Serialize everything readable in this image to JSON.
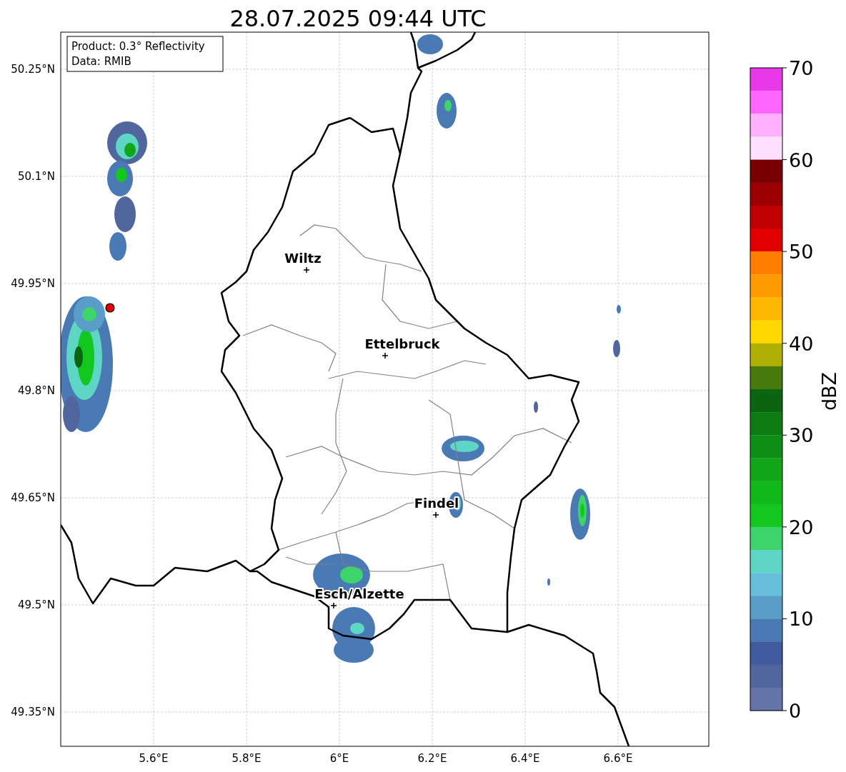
{
  "title": "28.07.2025 09:44 UTC",
  "map": {
    "info_lines": [
      "Product: 0.3° Reflectivity",
      "Data: RMIB"
    ],
    "lat_labels": [
      "50.25°N",
      "50.1°N",
      "49.95°N",
      "49.8°N",
      "49.65°N",
      "49.5°N",
      "49.35°N"
    ],
    "lon_labels": [
      "5.6°E",
      "5.8°E",
      "6°E",
      "6.2°E",
      "6.4°E",
      "6.6°E"
    ],
    "cities": [
      {
        "name": "Wiltz"
      },
      {
        "name": "Ettelbruck"
      },
      {
        "name": "Findel"
      },
      {
        "name": "Esch/Alzette"
      }
    ]
  },
  "colorbar": {
    "label": "dBZ",
    "ticks": [
      "70",
      "60",
      "50",
      "40",
      "30",
      "20",
      "10",
      "0"
    ],
    "bins": [
      {
        "color": "#e838e8"
      },
      {
        "color": "#ff66ff"
      },
      {
        "color": "#ffb0ff"
      },
      {
        "color": "#ffe0ff"
      },
      {
        "color": "#780000"
      },
      {
        "color": "#9c0000"
      },
      {
        "color": "#c00000"
      },
      {
        "color": "#e00000"
      },
      {
        "color": "#ff7e00"
      },
      {
        "color": "#ff9a00"
      },
      {
        "color": "#ffb800"
      },
      {
        "color": "#ffd800"
      },
      {
        "color": "#b0b004"
      },
      {
        "color": "#467a0a"
      },
      {
        "color": "#0a6410"
      },
      {
        "color": "#0c7c12"
      },
      {
        "color": "#0e8e14"
      },
      {
        "color": "#10a618"
      },
      {
        "color": "#10b81a"
      },
      {
        "color": "#12c81e"
      },
      {
        "color": "#3ed46c"
      },
      {
        "color": "#5ed6c6"
      },
      {
        "color": "#66c0dc"
      },
      {
        "color": "#5a9dc8"
      },
      {
        "color": "#4a7ab4"
      },
      {
        "color": "#425aa0"
      },
      {
        "color": "#52669e"
      },
      {
        "color": "#6474a8"
      }
    ]
  }
}
